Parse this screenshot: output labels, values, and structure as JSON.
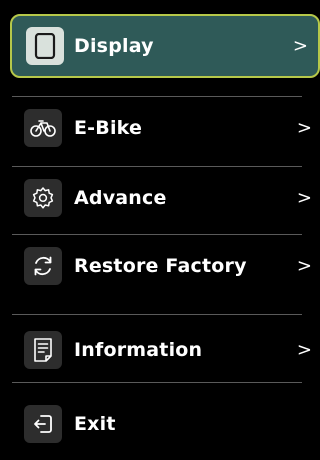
{
  "menu": {
    "items": [
      {
        "label": "Display",
        "icon": "tablet-icon",
        "chevron": ">",
        "selected": true
      },
      {
        "label": "E-Bike",
        "icon": "bicycle-icon",
        "chevron": ">"
      },
      {
        "label": "Advance",
        "icon": "gear-icon",
        "chevron": ">"
      },
      {
        "label": "Restore Factory",
        "icon": "restore-icon",
        "chevron": ">"
      },
      {
        "label": "Information",
        "icon": "document-icon",
        "chevron": ">"
      },
      {
        "label": "Exit",
        "icon": "exit-icon"
      }
    ]
  },
  "colors": {
    "background": "#000000",
    "selected_fill": "#2f5a58",
    "selected_border": "#b6c84a",
    "icon_tile": "#2d2d2d",
    "divider": "#5a5a5a",
    "text": "#ffffff"
  }
}
